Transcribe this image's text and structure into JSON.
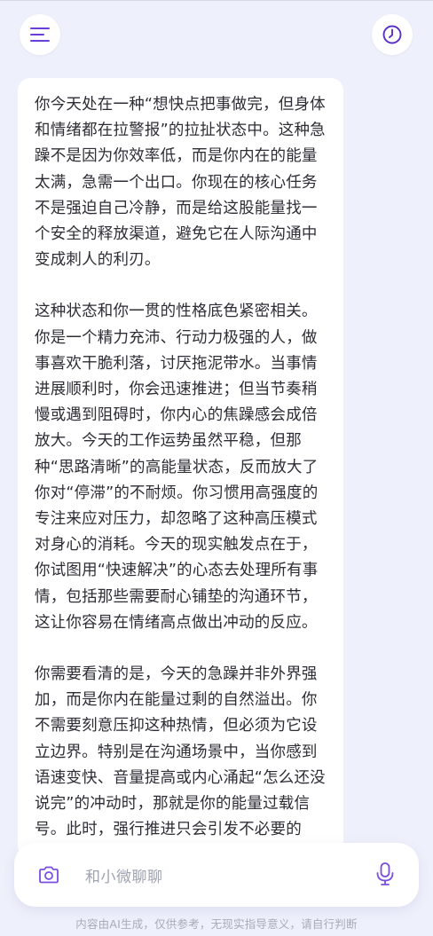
{
  "header": {
    "menu_icon": "menu-icon",
    "history_icon": "clock-icon"
  },
  "message": {
    "paragraphs": [
      "你今天处在一种“想快点把事做完，但身体和情绪都在拉警报”的拉扯状态中。这种急躁不是因为你效率低，而是你内在的能量太满，急需一个出口。你现在的核心任务不是强迫自己冷静，而是给这股能量找一个安全的释放渠道，避免它在人际沟通中变成刺人的利刃。",
      "这种状态和你一贯的性格底色紧密相关。你是一个精力充沛、行动力极强的人，做事喜欢干脆利落，讨厌拖泥带水。当事情进展顺利时，你会迅速推进；但当节奏稍慢或遇到阻碍时，你内心的焦躁感会成倍放大。今天的工作运势虽然平稳，但那种“思路清晰”的高能量状态，反而放大了你对“停滞”的不耐烦。你习惯用高强度的专注来应对压力，却忽略了这种高压模式对身心的消耗。今天的现实触发点在于，你试图用“快速解决”的心态去处理所有事情，包括那些需要耐心铺垫的沟通环节，这让你容易在情绪高点做出冲动的反应。",
      "你需要看清的是，今天的急躁并非外界强加，而是你内在能量过剩的自然溢出。你不需要刻意压抑这种热情，但必须为它设立边界。特别是在沟通场景中，当你感到语速变快、音量提高或内心涌起“怎么还没说完”的冲动时，那就是你的能量过载信号。此时，强行推进只会引发不必要的"
    ]
  },
  "input": {
    "placeholder": "和小微聊聊",
    "camera_icon": "camera-icon",
    "mic_icon": "microphone-icon"
  },
  "footer": {
    "disclaimer": "内容由AI生成，仅供参考，无现实指导意义，请自行判断"
  },
  "colors": {
    "accent": "#6a3fd9",
    "background": "#eef0fb",
    "card": "#ffffff",
    "text": "#2d2d35",
    "placeholder": "#9fa3b0",
    "disclaimer": "#a8aab6"
  }
}
